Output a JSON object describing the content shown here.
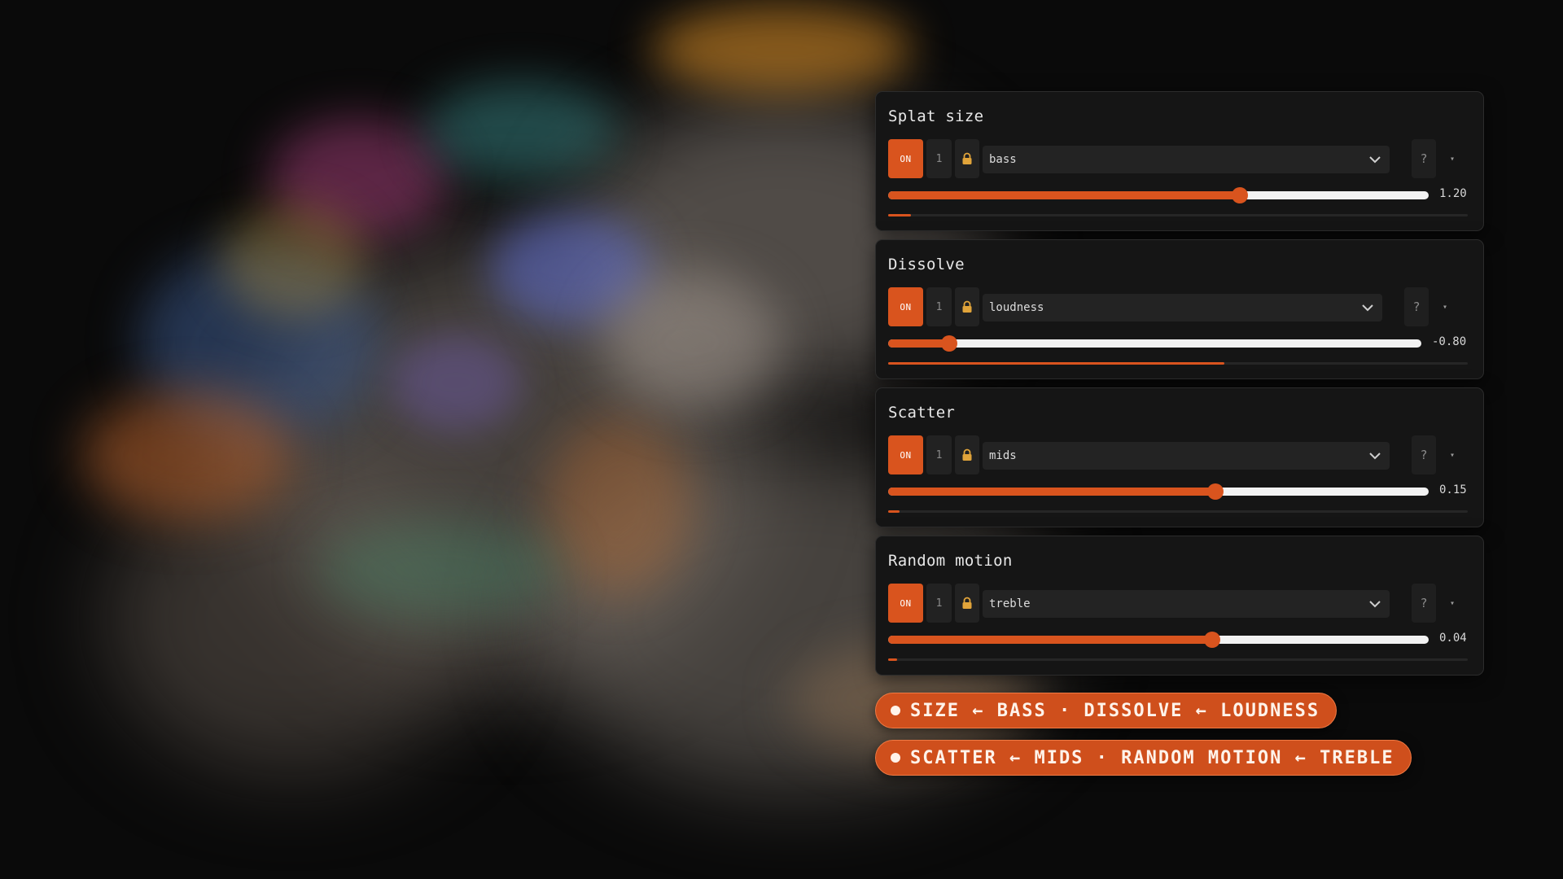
{
  "colors": {
    "accent": "#d9541e",
    "panel_bg": "#151515",
    "tag_bg": "#cf4f1c"
  },
  "panels": [
    {
      "title": "Splat size",
      "on_label": "ON",
      "channel": "1",
      "icon": "lock-icon",
      "source": "bass",
      "help": "?",
      "menu": "▾",
      "value_text": "1.20",
      "slider_fraction": 0.65,
      "meter_fraction": 0.04
    },
    {
      "title": "Dissolve",
      "on_label": "ON",
      "channel": "1",
      "icon": "lock-icon",
      "source": "loudness",
      "help": "?",
      "menu": "▾",
      "value_text": "-0.80",
      "slider_fraction": 0.115,
      "meter_fraction": 0.58
    },
    {
      "title": "Scatter",
      "on_label": "ON",
      "channel": "1",
      "icon": "lock-icon",
      "source": "mids",
      "help": "?",
      "menu": "▾",
      "value_text": "0.15",
      "slider_fraction": 0.605,
      "meter_fraction": 0.02
    },
    {
      "title": "Random motion",
      "on_label": "ON",
      "channel": "1",
      "icon": "lock-icon",
      "source": "treble",
      "help": "?",
      "menu": "▾",
      "value_text": "0.04",
      "slider_fraction": 0.6,
      "meter_fraction": 0.015
    }
  ],
  "tags": [
    {
      "text": "SIZE ← BASS · DISSOLVE ← LOUDNESS"
    },
    {
      "text": "SCATTER ← MIDS · RANDOM MOTION ← TREBLE"
    }
  ]
}
